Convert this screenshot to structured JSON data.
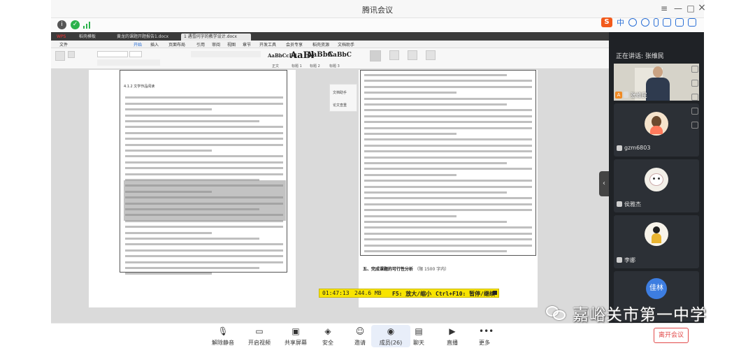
{
  "window": {
    "title": "腾讯会议",
    "controls": {
      "menu": "≡",
      "minimize": "—",
      "restore": "□",
      "close": "×"
    }
  },
  "infobar": {
    "tray_label": "中",
    "ime_icons": [
      "sogou-icon",
      "moon-icon",
      "emoji-icon",
      "voice-icon",
      "keyboard-icon",
      "shirt-icon",
      "grid-icon"
    ]
  },
  "shared_screen": {
    "browser_tabs": [
      "WPS",
      "稻壳模板",
      "黄龙的课题开题报告1.docx",
      "1 遇雪问字的教学设计.docx"
    ],
    "ribbon_menu": [
      "文件",
      "开始",
      "插入",
      "页面布局",
      "引用",
      "审阅",
      "视图",
      "章节",
      "开发工具",
      "会员专享",
      "稻壳资源",
      "文档助手"
    ],
    "styles": [
      "AaBbCcDd",
      "AaBl",
      "AaBbC",
      "AaBbC"
    ],
    "style_labels": [
      "正文",
      "标题 1",
      "标题 2",
      "标题 3"
    ],
    "side_panel_items": [
      "文档助手",
      "论文查重"
    ],
    "left_doc_heading": "4.1.2 文学作品阅读",
    "right_doc_heading": "五、完成课题的可行性分析",
    "right_doc_subtext": "（限 1500 字内）",
    "status": {
      "time": "01:47:13",
      "size": "244.6 MB",
      "zoom_hint": "F5: 放大/缩小",
      "pause_hint": "Ctrl+F10: 暂停/继续"
    }
  },
  "participants_panel": {
    "speaking_label": "正在讲话: 张维民",
    "participants": [
      {
        "name": "张维民",
        "badge": "A"
      },
      {
        "name": "gzm6803"
      },
      {
        "name": "侯雅杰"
      },
      {
        "name": "李娜"
      },
      {
        "name": "佳林",
        "avatar_text": "佳林"
      }
    ]
  },
  "toolbar": {
    "buttons": [
      {
        "label": "解除静音",
        "icon": "mic-muted-icon"
      },
      {
        "label": "开启视频",
        "icon": "camera-off-icon"
      },
      {
        "label": "共享屏幕",
        "icon": "share-screen-icon"
      },
      {
        "label": "安全",
        "icon": "shield-icon"
      },
      {
        "label": "邀请",
        "icon": "invite-icon"
      },
      {
        "label": "成员(26)",
        "icon": "members-icon"
      },
      {
        "label": "聊天",
        "icon": "chat-icon"
      },
      {
        "label": "直播",
        "icon": "live-icon"
      },
      {
        "label": "更多",
        "icon": "more-icon"
      }
    ],
    "leave_label": "离开会议"
  },
  "watermark": {
    "text": "嘉峪关市第一中学"
  },
  "colors": {
    "accent": "#2a6fd6",
    "status_bg": "#f8e400",
    "leave": "#e24a4a",
    "panel_bg": "#1f2226"
  }
}
